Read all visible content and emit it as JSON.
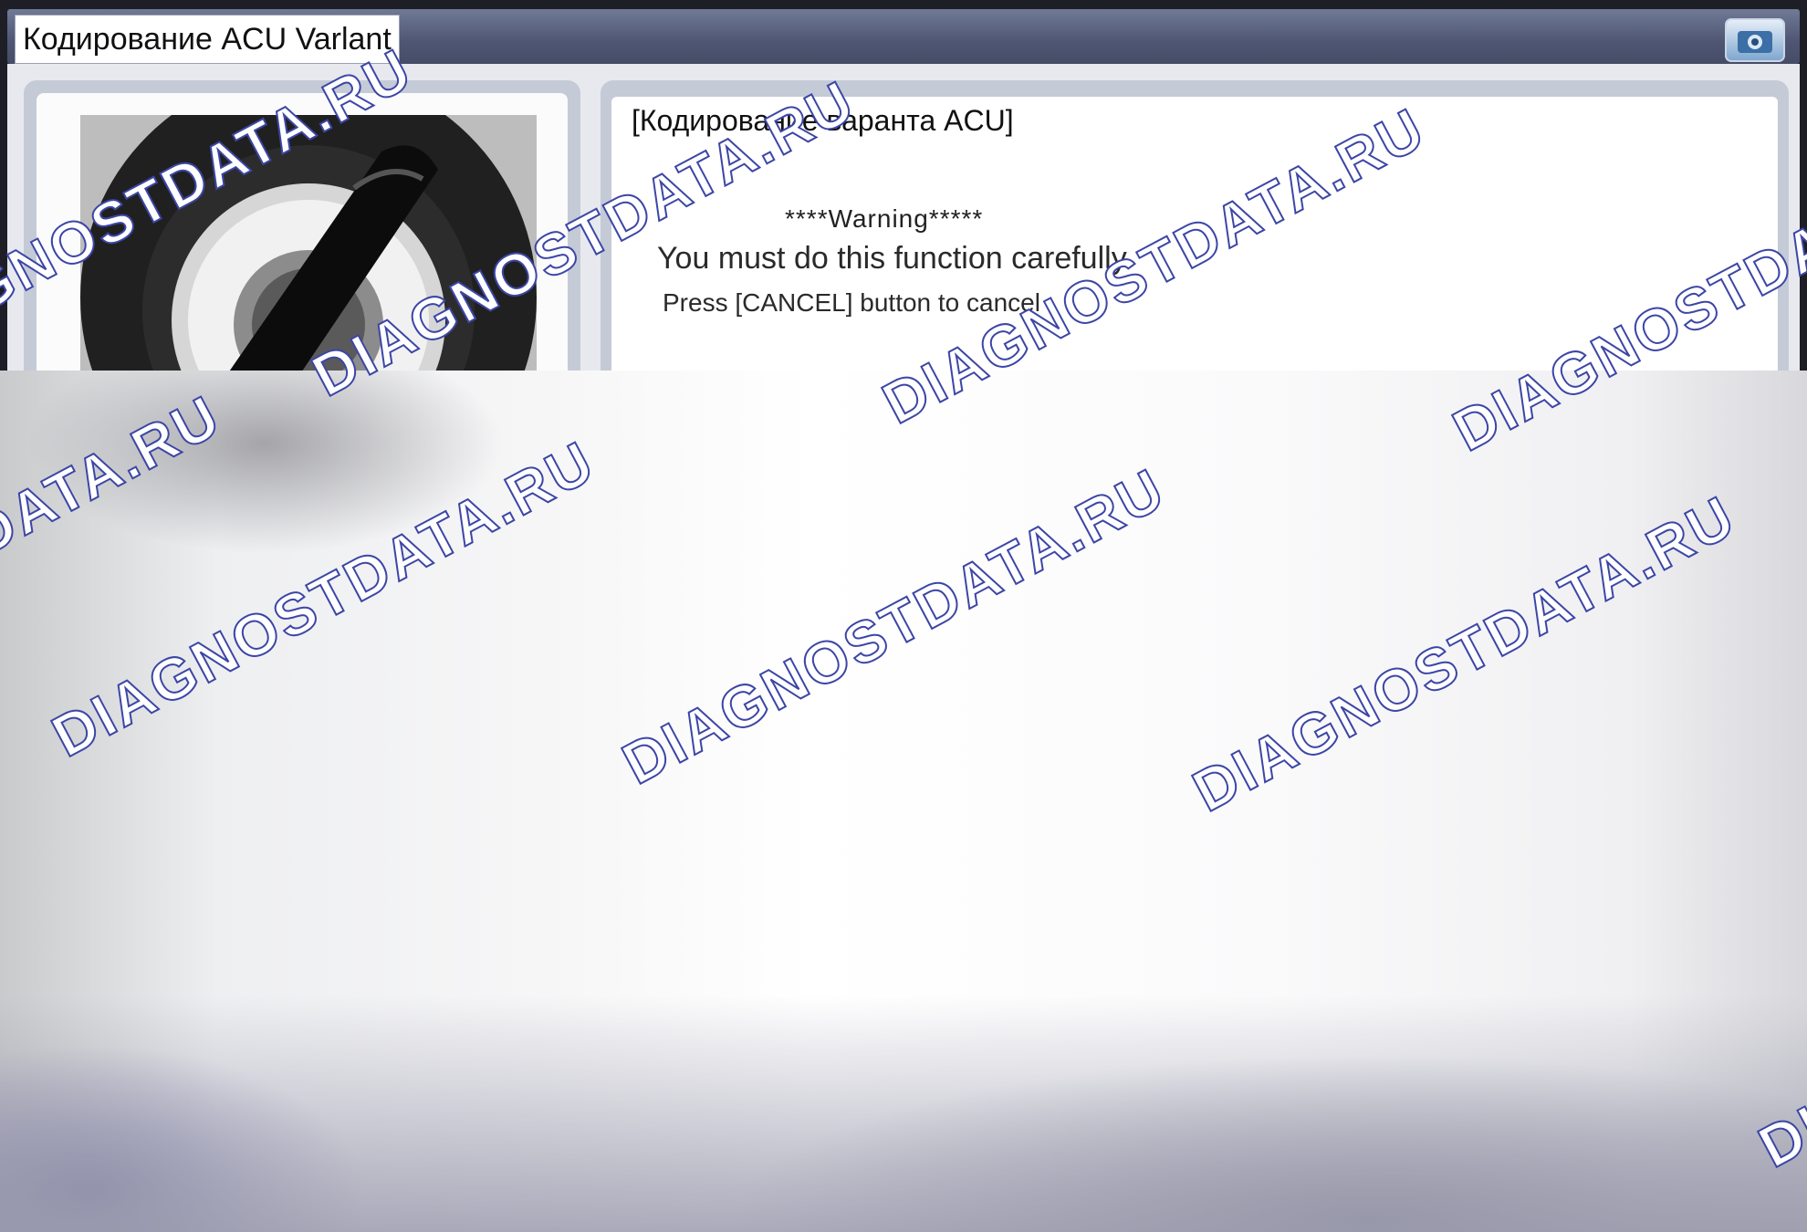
{
  "window": {
    "title": "Кодирование ACU Varlant"
  },
  "left_panel": {
    "image": "ignition-key-photo"
  },
  "right_panel": {
    "heading": "[Кодирование варанта ACU]",
    "warning_title": "****Warning*****",
    "warning_line1": "You must do this function carefully",
    "warning_line2": "Press [CANCEL] button to cancel"
  },
  "watermark": {
    "text": "DIAGNOSTDATA.RU"
  },
  "icons": {
    "title_bar": "camera-icon"
  }
}
